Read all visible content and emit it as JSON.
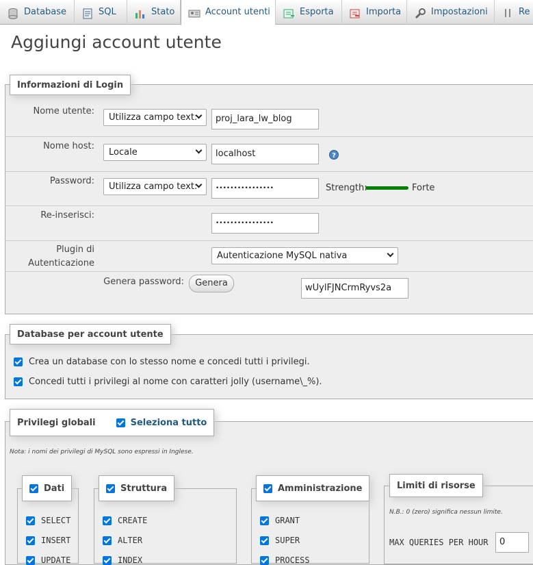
{
  "tabs": [
    {
      "label": "Database",
      "icon": "database-icon"
    },
    {
      "label": "SQL",
      "icon": "sql-icon"
    },
    {
      "label": "Stato",
      "icon": "status-icon"
    },
    {
      "label": "Account utenti",
      "icon": "users-icon"
    },
    {
      "label": "Esporta",
      "icon": "export-icon"
    },
    {
      "label": "Importa",
      "icon": "import-icon"
    },
    {
      "label": "Impostazioni",
      "icon": "wrench-icon"
    },
    {
      "label": "Re",
      "icon": "replication-icon"
    }
  ],
  "page_title": "Aggiungi account utente",
  "login": {
    "legend": "Informazioni di Login",
    "username_label": "Nome utente:",
    "username_mode": "Utilizza campo text:",
    "username_value": "proj_lara_lw_blog",
    "host_label": "Nome host:",
    "host_mode": "Locale",
    "host_value": "localhost",
    "password_label": "Password:",
    "password_mode": "Utilizza campo text:",
    "password_value": "••••••••••••••••",
    "strength_label": "Strength:",
    "strength_value": "Forte",
    "strength_color": "#008000",
    "reenter_label": "Re-inserisci:",
    "reenter_value": "••••••••••••••••",
    "plugin_label_1": "Plugin di",
    "plugin_label_2": "Autenticazione",
    "plugin_value": "Autenticazione MySQL nativa",
    "generate_label": "Genera password:",
    "generate_button": "Genera",
    "generated_value": "wUylFJNCrmRyvs2a"
  },
  "database": {
    "legend": "Database per account utente",
    "option1": "Crea un database con lo stesso nome e concedi tutti i privilegi.",
    "option2": "Concedi tutti i privilegi al nome con caratteri jolly (username\\_%)."
  },
  "privileges": {
    "legend": "Privilegi globali",
    "select_all": "Seleziona tutto",
    "note": "Nota: i nomi dei privilegi di MySQL sono espressi in Inglese.",
    "groups": {
      "data": {
        "label": "Dati",
        "items": [
          "SELECT",
          "INSERT",
          "UPDATE"
        ]
      },
      "structure": {
        "label": "Struttura",
        "items": [
          "CREATE",
          "ALTER",
          "INDEX"
        ]
      },
      "admin": {
        "label": "Amministrazione",
        "items": [
          "GRANT",
          "SUPER",
          "PROCESS"
        ]
      }
    },
    "limits": {
      "label": "Limiti di risorse",
      "note": "N.B.: 0 (zero) significa nessun limite.",
      "max_queries_label": "MAX QUERIES PER HOUR",
      "max_queries_value": "0"
    }
  },
  "colors": {
    "accent": "#235a81",
    "checkbox": "#0075db",
    "panel": "#eeeeee"
  }
}
